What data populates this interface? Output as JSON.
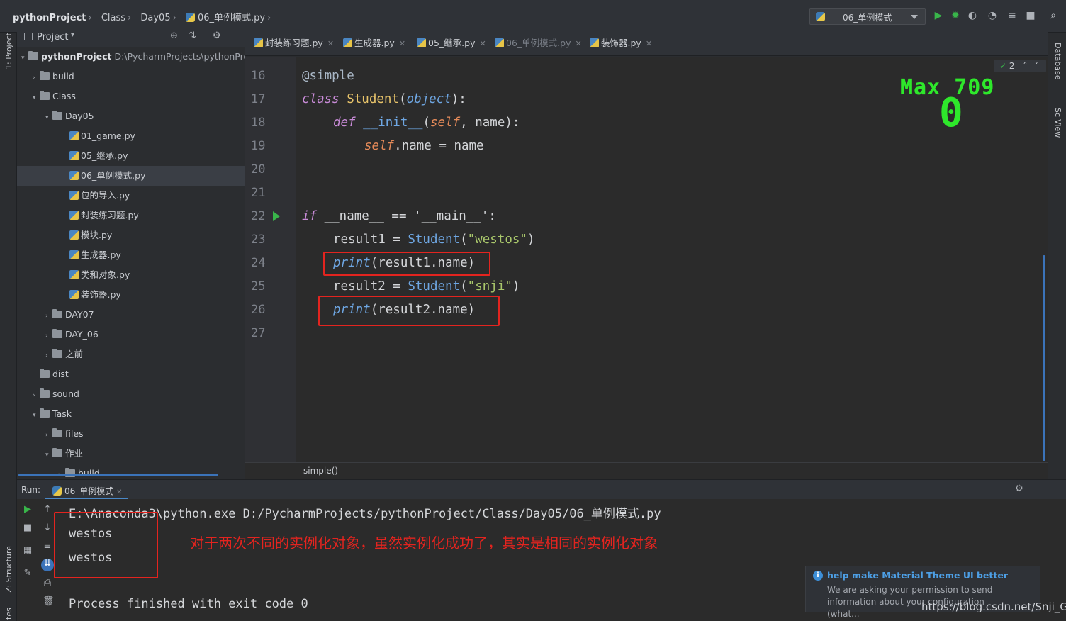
{
  "breadcrumb": {
    "project": "pythonProject",
    "folder": "Class",
    "subfolder": "Day05",
    "file": "06_单例模式.py"
  },
  "run_config": {
    "selected": "06_单例模式"
  },
  "left_strip": {
    "project_tab": "1: Project",
    "structure_tab": "Z: Structure",
    "favorites_tab": "tes"
  },
  "right_strip": {
    "database_tab": "Database",
    "sciview_tab": "SciView"
  },
  "project_panel": {
    "title": "Project",
    "tree": [
      {
        "label": "pythonProject",
        "path": "D:\\PycharmProjects\\pythonProjec",
        "type": "root"
      },
      {
        "label": "build",
        "type": "folder"
      },
      {
        "label": "Class",
        "type": "folder"
      },
      {
        "label": "Day05",
        "type": "folder"
      },
      {
        "label": "01_game.py",
        "type": "file"
      },
      {
        "label": "05_继承.py",
        "type": "file"
      },
      {
        "label": "06_单例模式.py",
        "type": "file",
        "selected": true
      },
      {
        "label": "包的导入.py",
        "type": "file"
      },
      {
        "label": "封装练习题.py",
        "type": "file"
      },
      {
        "label": "模块.py",
        "type": "file"
      },
      {
        "label": "生成器.py",
        "type": "file"
      },
      {
        "label": "类和对象.py",
        "type": "file"
      },
      {
        "label": "装饰器.py",
        "type": "file"
      },
      {
        "label": "DAY07",
        "type": "folder"
      },
      {
        "label": "DAY_06",
        "type": "folder"
      },
      {
        "label": "之前",
        "type": "folder"
      },
      {
        "label": "dist",
        "type": "folder"
      },
      {
        "label": "sound",
        "type": "folder"
      },
      {
        "label": "Task",
        "type": "folder"
      },
      {
        "label": "files",
        "type": "folder"
      },
      {
        "label": "作业",
        "type": "folder"
      },
      {
        "label": "build",
        "type": "folder"
      }
    ]
  },
  "tabs": [
    {
      "label": "封装练习题.py"
    },
    {
      "label": "生成器.py"
    },
    {
      "label": "05_继承.py"
    },
    {
      "label": "06_单例模式.py",
      "active": true
    },
    {
      "label": "装饰器.py"
    }
  ],
  "editor": {
    "line_numbers": [
      "16",
      "17",
      "18",
      "19",
      "20",
      "21",
      "22",
      "23",
      "24",
      "25",
      "26",
      "27"
    ],
    "lines": {
      "l16": "@simple",
      "l17_kw": "class",
      "l17_name": "Student",
      "l17_base": "object",
      "l18_kw": "def",
      "l18_fn": "__init__",
      "l18_self": "self",
      "l18_rest": ", name):",
      "l19_self": "self",
      "l19_rest": ".name = name",
      "l22_kw": "if",
      "l22_rest": " __name__ == '__main__':",
      "l23_a": "result1 = ",
      "l23_cls": "Student",
      "l23_str": "\"westos\"",
      "l24_fn": "print",
      "l24_rest": "(result1.name)",
      "l25_a": "result2 = ",
      "l25_cls": "Student",
      "l25_str": "\"snji\"",
      "l26_fn": "print",
      "l26_rest": "(result2.name)"
    },
    "inspection_count": "2",
    "overlay_max": "Max 709",
    "overlay_value": "0",
    "breadcrumb_fn": "simple()"
  },
  "run_panel": {
    "label": "Run:",
    "tab": "06_单例模式",
    "command": "E:\\Anaconda3\\python.exe D:/PycharmProjects/pythonProject/Class/Day05/06_单例模式.py",
    "outputs": [
      "westos",
      "westos"
    ],
    "exit_line": "Process finished with exit code 0"
  },
  "annotation": "对于两次不同的实例化对象，虽然实例化成功了，其实是相同的实例化对象",
  "notification": {
    "title": "help make Material Theme UI better",
    "body": "We are asking your permission to send information about your configuration (what..."
  },
  "watermark": "https://blog.csdn.net/Snji_G",
  "colors": {
    "accent": "#4a88c7",
    "highlight_box": "#e3241f",
    "overlay_green": "#2ee82b"
  }
}
